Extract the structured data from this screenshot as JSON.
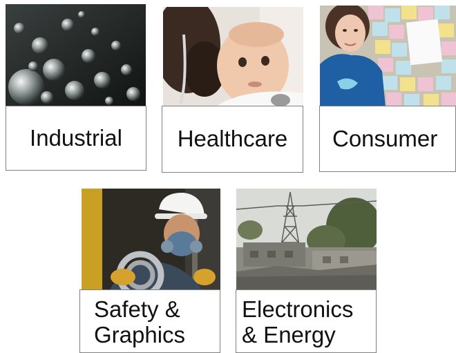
{
  "tiles": [
    {
      "id": "industrial",
      "label_lines": [
        "Industrial"
      ],
      "photo": "glass-bubbles-photo"
    },
    {
      "id": "healthcare",
      "label_lines": [
        "Healthcare"
      ],
      "photo": "baby-stethoscope-photo"
    },
    {
      "id": "consumer",
      "label_lines": [
        "Consumer"
      ],
      "photo": "sticky-notes-woman-photo"
    },
    {
      "id": "safety-graphics",
      "label_lines": [
        "Safety &",
        "Graphics"
      ],
      "photo": "respirator-worker-photo"
    },
    {
      "id": "electronics-energy",
      "label_lines": [
        "Electronics",
        "& Energy"
      ],
      "photo": "power-pylon-buildings-photo"
    }
  ]
}
